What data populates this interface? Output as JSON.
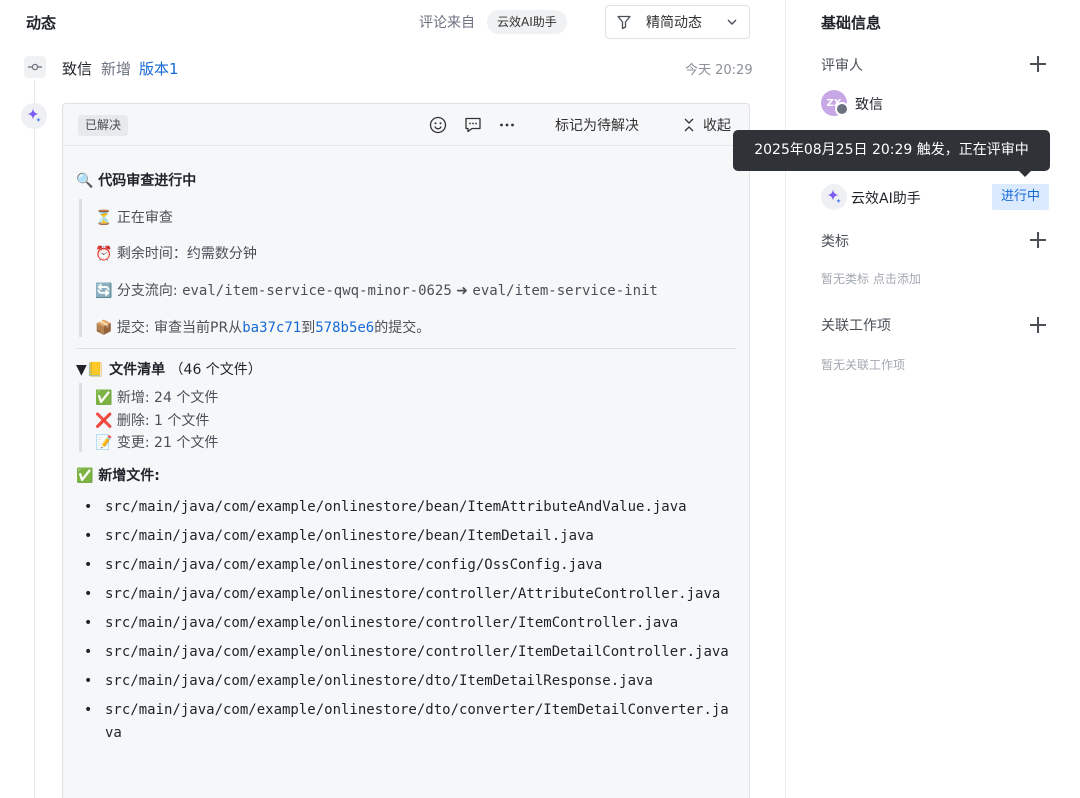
{
  "activity": {
    "title": "动态",
    "source_label": "评论来自",
    "source_chip": "云效AI助手",
    "filter_label": "精简动态"
  },
  "event": {
    "user": "致信",
    "verb": "新增",
    "link": "版本1",
    "time": "今天 20:29"
  },
  "comment": {
    "status_badge": "已解决",
    "mark_label": "标记为待解决",
    "collapse_label": "收起",
    "section_title": "🔍 代码审查进行中",
    "reviewing": "⏳ 正在审查",
    "remaining": "⏰ 剩余时间：约需数分钟",
    "branch_prefix": "🔄 分支流向: ",
    "branch_from": "eval/item-service-qwq-minor-0625",
    "branch_arrow": " ➜ ",
    "branch_to": "eval/item-service-init",
    "commit_prefix": "📦 提交: 审查当前PR从",
    "commit_from": "ba37c71",
    "commit_mid": "到",
    "commit_to": "578b5e6",
    "commit_suffix": "的提交。",
    "files_toggle": "▼",
    "files_title": "📒 文件清单",
    "files_count": "（46 个文件）",
    "summary_added": "✅ 新增: 24 个文件",
    "summary_deleted": "❌ 删除: 1 个文件",
    "summary_changed": "📝 变更: 21 个文件",
    "added_title": "✅ 新增文件:",
    "added_files": [
      "src/main/java/com/example/onlinestore/bean/ItemAttributeAndValue.java",
      "src/main/java/com/example/onlinestore/bean/ItemDetail.java",
      "src/main/java/com/example/onlinestore/config/OssConfig.java",
      "src/main/java/com/example/onlinestore/controller/AttributeController.java",
      "src/main/java/com/example/onlinestore/controller/ItemController.java",
      "src/main/java/com/example/onlinestore/controller/ItemDetailController.java",
      "src/main/java/com/example/onlinestore/dto/ItemDetailResponse.java",
      "src/main/java/com/example/onlinestore/dto/converter/ItemDetailConverter.java"
    ]
  },
  "panel": {
    "title": "基础信息",
    "reviewers_label": "评审人",
    "reviewer_name": "致信",
    "reviewer_initials": "ZX",
    "ai_name": "云效AI助手",
    "ai_status": "进行中",
    "tags_label": "类标",
    "tags_hint": "暂无类标 点击添加",
    "linked_label": "关联工作项",
    "linked_hint": "暂无关联工作项"
  },
  "tooltip": {
    "text": "2025年08月25日 20:29 触发，正在评审中"
  },
  "colors": {
    "accent": "#1769d6",
    "card_bg": "#f6f7f9",
    "status_bg": "#dbeafe",
    "tooltip_bg": "#2f3237"
  }
}
